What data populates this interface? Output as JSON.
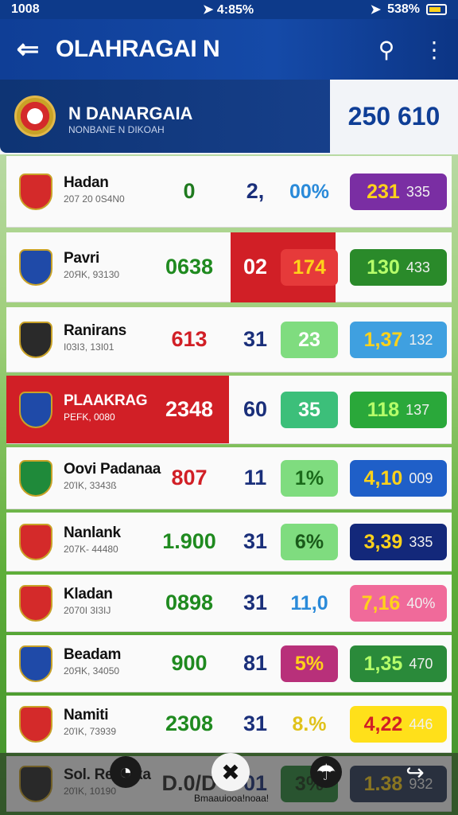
{
  "status_bar": {
    "time_left": "1008",
    "time_center": "4:85%",
    "battery_text": "538%"
  },
  "app_bar": {
    "title": "OLAHRAGAI N"
  },
  "featured": {
    "name": "N DANARGAIA",
    "subtitle": "NONBANE N DIKOAH",
    "score": "250 610"
  },
  "rows": [
    {
      "name": "Hadan",
      "sub": "207 20 0S4N0",
      "c1": "0",
      "c1_color": "#1f7a1f",
      "c2": "2,",
      "c3": "00%",
      "c3_bg": "transparent",
      "c3_color": "#2a8ad9",
      "c4_main": "231",
      "c4_small": "335",
      "c4_bg": "#7a2ea3",
      "c4_color": "#ffd21a",
      "logo_bg": "#d42a2a"
    },
    {
      "name": "Pavri",
      "sub": "20ЯK, 93130",
      "c1": "0638",
      "c1_color": "#1f8a1f",
      "c2": "02",
      "c3": "174",
      "c3_bg": "#e63a3a",
      "c3_color": "#ffd21a",
      "c4_main": "130",
      "c4_small": "433",
      "c4_bg": "#2a8a2a",
      "c4_color": "#b6ff6a",
      "logo_bg": "#1f4aa8"
    },
    {
      "name": "Ranirans",
      "sub": "I03I3, 13I01",
      "c1": "613",
      "c1_color": "#d11f26",
      "c2": "31",
      "c3": "23",
      "c3_bg": "#7fdc7f",
      "c3_color": "#ffffff",
      "c4_main": "1,37",
      "c4_small": "132",
      "c4_bg": "#3fa0e0",
      "c4_color": "#ffd21a",
      "logo_bg": "#2a2a2a"
    },
    {
      "name": "PLAAKRAG",
      "sub": "PEFK, 0080",
      "c1": "2348",
      "c1_color": "#ffffff",
      "c2": "60",
      "c3": "35",
      "c3_bg": "#3cbf7a",
      "c3_color": "#ffffff",
      "c4_main": "118",
      "c4_small": "137",
      "c4_bg": "#2aa83a",
      "c4_color": "#b6ff6a",
      "logo_bg": "#1f4aa8"
    },
    {
      "name": "Oovi Padanaa",
      "sub": "20ΊK, 3343ß",
      "c1": "807",
      "c1_color": "#d11f26",
      "c2": "11",
      "c3": "1%",
      "c3_bg": "#7fdc7f",
      "c3_color": "#1a6a1a",
      "c4_main": "4,10",
      "c4_small": "009",
      "c4_bg": "#1f5fc8",
      "c4_color": "#ffd21a",
      "logo_bg": "#1f8a3a"
    },
    {
      "name": "Nanlank",
      "sub": "207K- 44480",
      "c1": "1.900",
      "c1_color": "#1f8a1f",
      "c2": "31",
      "c3": "6%",
      "c3_bg": "#7fdc7f",
      "c3_color": "#1a5a1a",
      "c4_main": "3,39",
      "c4_small": "335",
      "c4_bg": "#13287a",
      "c4_color": "#ffd21a",
      "logo_bg": "#d42a2a"
    },
    {
      "name": "Kladan",
      "sub": "2070I 3I3IJ",
      "c1": "0898",
      "c1_color": "#1f8a1f",
      "c2": "31",
      "c3": "11,0",
      "c3_bg": "transparent",
      "c3_color": "#2a8ad9",
      "c4_main": "7,16",
      "c4_small": "40%",
      "c4_bg": "#f06a9a",
      "c4_color": "#ffd21a",
      "logo_bg": "#d42a2a"
    },
    {
      "name": "Beadam",
      "sub": "20ЯK, 34050",
      "c1": "900",
      "c1_color": "#1f8a1f",
      "c2": "81",
      "c3": "5%",
      "c3_bg": "#b8307a",
      "c3_color": "#ffd21a",
      "c4_main": "1,35",
      "c4_small": "470",
      "c4_bg": "#2a8a3a",
      "c4_color": "#b6ff6a",
      "logo_bg": "#1f4aa8"
    },
    {
      "name": "Namiti",
      "sub": "20ΊK, 73939",
      "c1": "2308",
      "c1_color": "#1f8a1f",
      "c2": "31",
      "c3": "8.%",
      "c3_bg": "transparent",
      "c3_color": "#e0c21a",
      "c4_main": "4,22",
      "c4_small": "446",
      "c4_bg": "#ffe01a",
      "c4_color": "#d11f26",
      "logo_bg": "#d42a2a"
    },
    {
      "name": "Sol. Remaka",
      "sub": "20ΊK, 10190",
      "c1": "D.0/D",
      "c1_color": "#2a2a2a",
      "c2": "01",
      "c3": "3%",
      "c3_bg": "#2a8a3a",
      "c3_color": "#1a3a1a",
      "c4_main": "1.38",
      "c4_small": "932",
      "c4_bg": "#2a3a5a",
      "c4_color": "#ffd21a",
      "logo_bg": "#2a2a2a"
    }
  ],
  "bottom_nav": {
    "caption": "Bmaauiooa!noaa!"
  }
}
